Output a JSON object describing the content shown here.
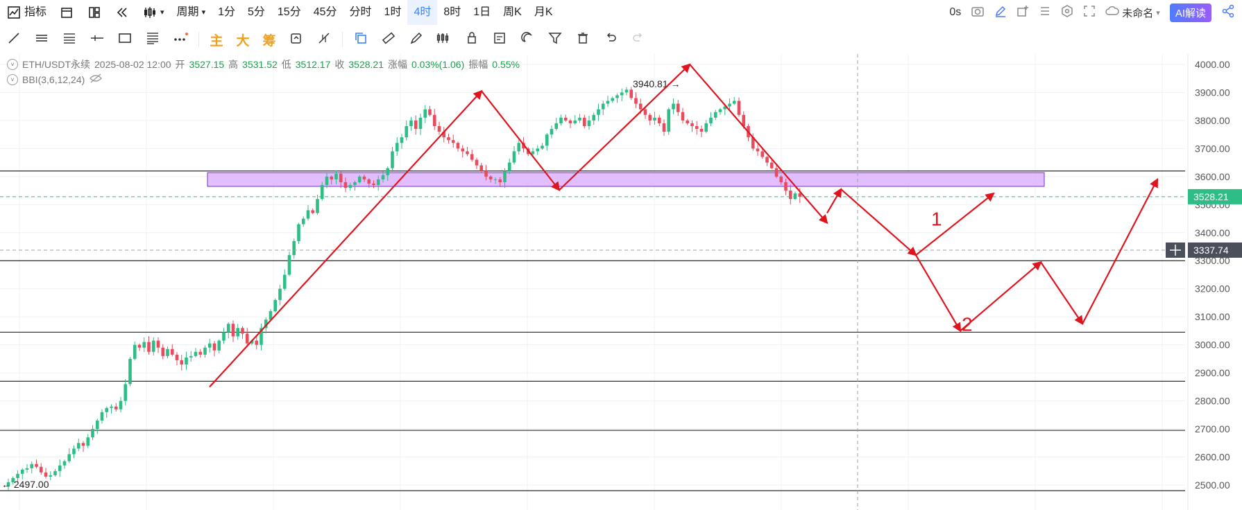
{
  "topbar": {
    "indicator_label": "指标",
    "period_label": "周期",
    "timeframes": [
      "1分",
      "5分",
      "15分",
      "45分",
      "分时",
      "1时",
      "4时",
      "8时",
      "1日",
      "周K",
      "月K"
    ],
    "active_timeframe": "4时",
    "countdown": "0s",
    "layout_name": "未命名",
    "ai_label": "AI解读"
  },
  "drawbar": {
    "labels": [
      "主",
      "大",
      "筹"
    ]
  },
  "legend": {
    "symbol": "ETH/USDT永续",
    "datetime": "2025-08-02 12:00",
    "open_label": "开",
    "open": "3527.15",
    "high_label": "高",
    "high": "3531.52",
    "low_label": "低",
    "low": "3512.17",
    "close_label": "收",
    "close": "3528.21",
    "change_label": "涨幅",
    "change": "0.03%(1.06)",
    "amp_label": "振幅",
    "amp": "0.55%",
    "indicator": "BBI(3,6,12,24)"
  },
  "colors": {
    "up": "#2ebd85",
    "down": "#e84b5c",
    "arrow": "#e0141e",
    "zone": "#d9a8ff",
    "zone_border": "#7b2fbf",
    "price_tag": "#2ebd85",
    "crosshair_tag": "#4a4f5a"
  },
  "chart_data": {
    "type": "candlestick",
    "symbol": "ETH/USDT永续",
    "interval": "4时",
    "ylim": [
      2480,
      4030
    ],
    "y_ticks": [
      2500,
      2600,
      2700,
      2800,
      2900,
      3000,
      3100,
      3200,
      3300,
      3400,
      3500,
      3600,
      3700,
      3800,
      3900,
      4000
    ],
    "price_tag": 3528.21,
    "crosshair_price": 3337.74,
    "high_label": "3940.81",
    "low_label": "2497.00",
    "support_lines": [
      3620,
      3300,
      3045,
      2870,
      2695,
      2480
    ],
    "resistance_zone": [
      3565,
      3614
    ],
    "projection_labels": [
      "1",
      "2"
    ],
    "closes": [
      2510,
      2525,
      2540,
      2555,
      2560,
      2575,
      2565,
      2545,
      2530,
      2535,
      2550,
      2570,
      2585,
      2610,
      2630,
      2650,
      2640,
      2670,
      2700,
      2730,
      2760,
      2775,
      2780,
      2770,
      2800,
      2860,
      2950,
      3000,
      2990,
      3010,
      2975,
      3015,
      2990,
      2960,
      2985,
      2965,
      2945,
      2930,
      2955,
      2960,
      2975,
      2965,
      2990,
      3005,
      2980,
      3015,
      3045,
      3075,
      3030,
      3060,
      3040,
      3005,
      3015,
      3000,
      3060,
      3090,
      3120,
      3160,
      3200,
      3250,
      3320,
      3370,
      3430,
      3450,
      3480,
      3470,
      3520,
      3570,
      3600,
      3590,
      3610,
      3580,
      3560,
      3570,
      3580,
      3600,
      3590,
      3575,
      3570,
      3590,
      3605,
      3630,
      3690,
      3720,
      3740,
      3780,
      3800,
      3770,
      3810,
      3840,
      3820,
      3780,
      3760,
      3740,
      3730,
      3720,
      3700,
      3690,
      3680,
      3660,
      3640,
      3620,
      3600,
      3590,
      3590,
      3580,
      3620,
      3650,
      3690,
      3720,
      3700,
      3680,
      3690,
      3700,
      3710,
      3750,
      3770,
      3790,
      3810,
      3800,
      3790,
      3800,
      3810,
      3780,
      3800,
      3820,
      3840,
      3860,
      3870,
      3880,
      3890,
      3900,
      3910,
      3880,
      3860,
      3840,
      3820,
      3800,
      3810,
      3790,
      3760,
      3840,
      3860,
      3830,
      3800,
      3790,
      3780,
      3770,
      3760,
      3790,
      3810,
      3830,
      3840,
      3850,
      3860,
      3870,
      3820,
      3780,
      3740,
      3700,
      3690,
      3670,
      3650,
      3630,
      3600,
      3580,
      3550,
      3520,
      3540,
      3528
    ]
  }
}
